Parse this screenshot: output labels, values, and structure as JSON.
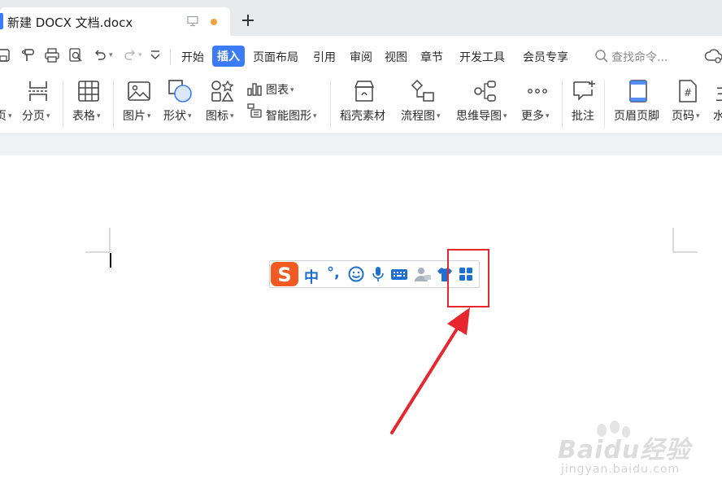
{
  "tabbar": {
    "doc_title": "新建 DOCX 文档.docx",
    "new_tab_symbol": "+"
  },
  "menu": {
    "tabs": [
      "开始",
      "插入",
      "页面布局",
      "引用",
      "审阅",
      "视图",
      "章节",
      "开发工具",
      "会员专享"
    ],
    "active_tab": "插入",
    "search_placeholder": "查找命令..."
  },
  "ribbon": {
    "page_partial_label": "页",
    "page_break": "分页",
    "table": "表格",
    "picture": "图片",
    "shape": "形状",
    "icon_lib": "图标",
    "chart": "图表",
    "smart_art": "智能图形",
    "docer_material": "稻壳素材",
    "flowchart": "流程图",
    "mindmap": "思维导图",
    "more": "更多",
    "comment": "批注",
    "header_footer": "页眉页脚",
    "page_number": "页码",
    "watermark_partial": "水"
  },
  "ime_bar": {
    "logo_letter": "S",
    "mode": "中",
    "punct": "°,"
  },
  "watermark": {
    "brand": "Baidu经验",
    "url": "jingyan.baidu.com"
  },
  "colors": {
    "accent_blue": "#3b7bf6",
    "ime_orange": "#f25a22",
    "ime_blue": "#1d6fd0",
    "highlight_red": "#e8262d",
    "unsaved_dot": "#f0a23c"
  }
}
